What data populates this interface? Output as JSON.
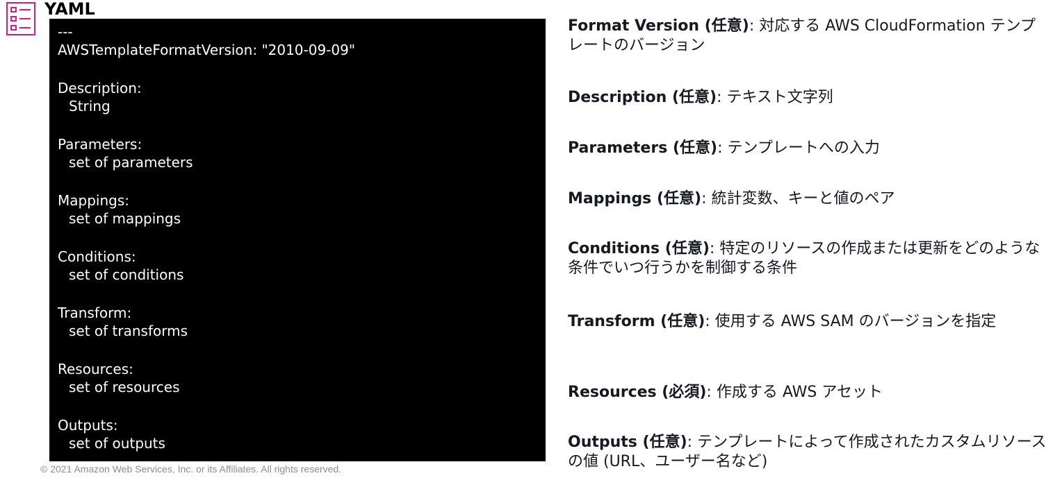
{
  "header": {
    "title": "YAML"
  },
  "code": {
    "lines": [
      "---",
      "AWSTemplateFormatVersion: \"2010-09-09\"",
      "Description:",
      "String",
      "Parameters:",
      "set of parameters",
      "Mappings:",
      "set of mappings",
      "Conditions:",
      "set of conditions",
      "Transform:",
      "set of transforms",
      "Resources:",
      "set of resources",
      "Outputs:",
      "set of outputs"
    ]
  },
  "descriptions": [
    {
      "term": "Format Version (任意)",
      "text": ": 対応する AWS CloudFormation テンプレートのバージョン"
    },
    {
      "term": "Description (任意)",
      "text": ": テキスト文字列"
    },
    {
      "term": "Parameters (任意)",
      "text": ": テンプレートへの入力"
    },
    {
      "term": "Mappings (任意)",
      "text": ": 統計変数、キーと値のペア"
    },
    {
      "term": "Conditions (任意)",
      "text": ": 特定のリソースの作成または更新をどのような条件でいつ行うかを制御する条件"
    },
    {
      "term": "Transform (任意)",
      "text": ": 使用する AWS SAM のバージョンを指定"
    },
    {
      "term": "Resources (必須)",
      "text": ": 作成する AWS アセット"
    },
    {
      "term": "Outputs (任意)",
      "text": ": テンプレートによって作成されたカスタムリソースの値 (URL、ユーザー名など)"
    }
  ],
  "footer": {
    "copyright": "© 2021 Amazon Web Services, Inc. or its Affiliates. All rights reserved."
  },
  "colors": {
    "icon": "#e7157b",
    "code_background": "#000000",
    "code_text": "#ffffff"
  }
}
